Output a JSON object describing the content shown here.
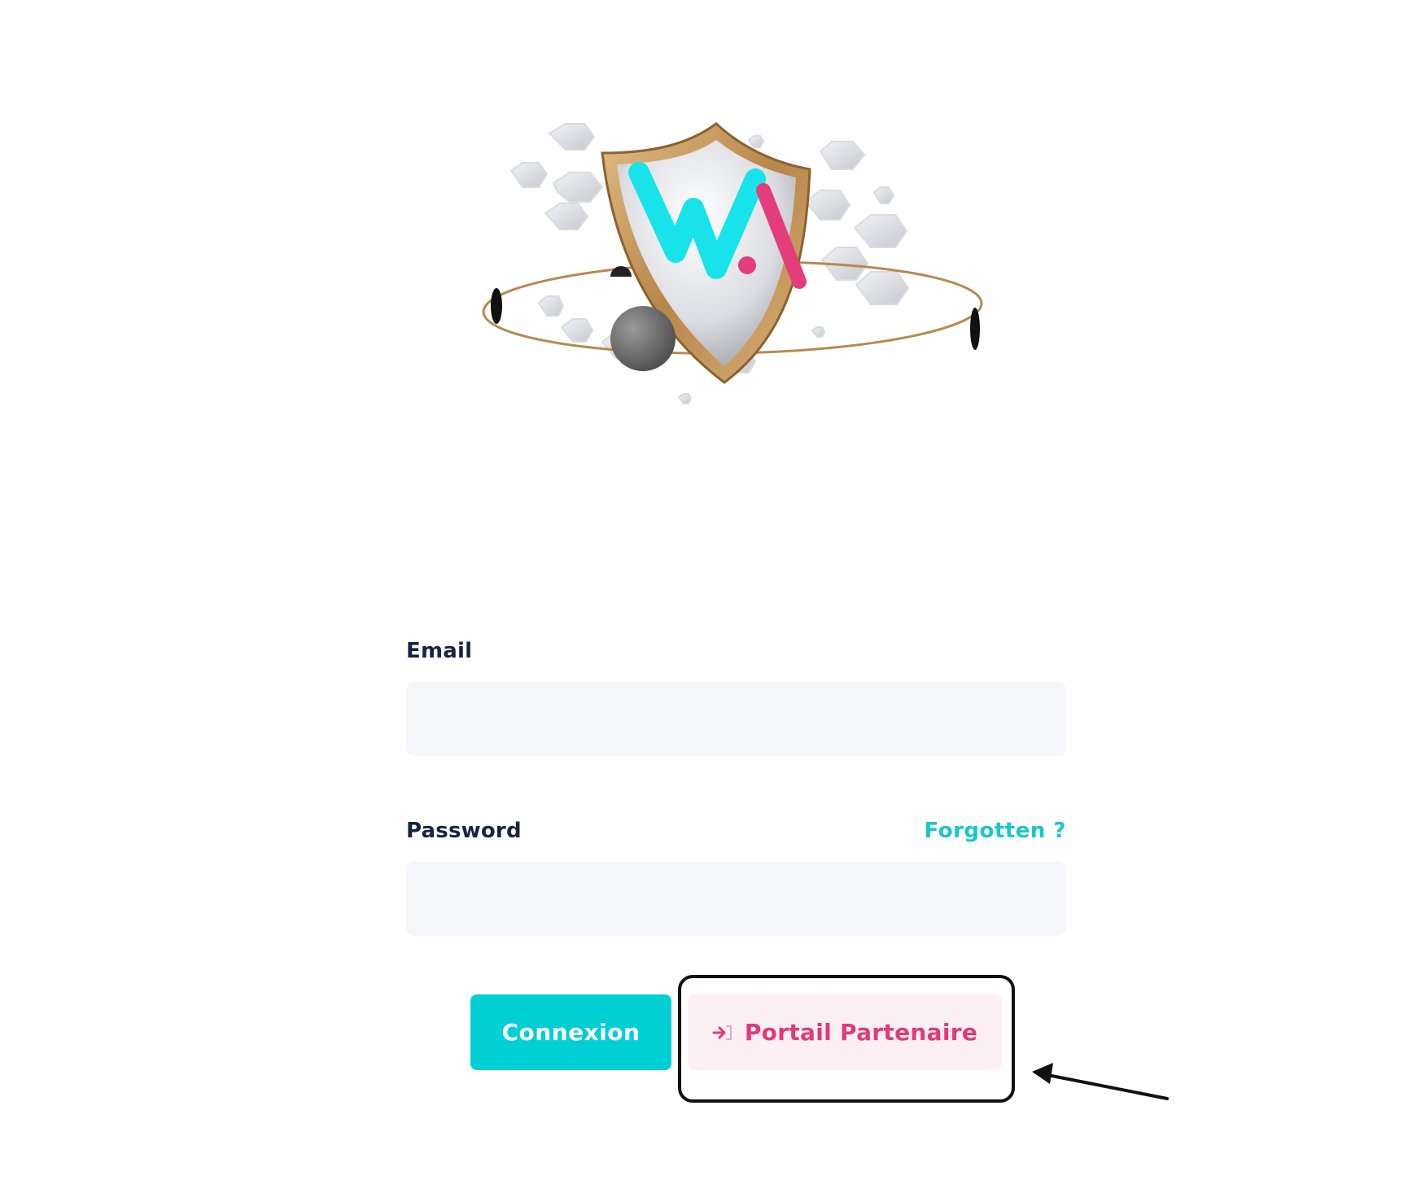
{
  "logo": {
    "monogram": "W.A",
    "colors": {
      "cyan": "#19e3ea",
      "pink": "#e33d7b",
      "gold": "#c9a064"
    }
  },
  "form": {
    "email_label": "Email",
    "email_value": "",
    "email_placeholder": "",
    "password_label": "Password",
    "password_value": "",
    "password_placeholder": "",
    "forgot_label": "Forgotten ?"
  },
  "actions": {
    "connexion_label": "Connexion",
    "partenaire_label": "Portail Partenaire",
    "partenaire_icon": "login-arrow-icon"
  },
  "colors": {
    "primary": "#00cfd3",
    "partner_text": "#e23a78",
    "partner_bg": "#fdf0f4",
    "field_bg": "#f4f6f9",
    "label_text": "#1b2340"
  }
}
